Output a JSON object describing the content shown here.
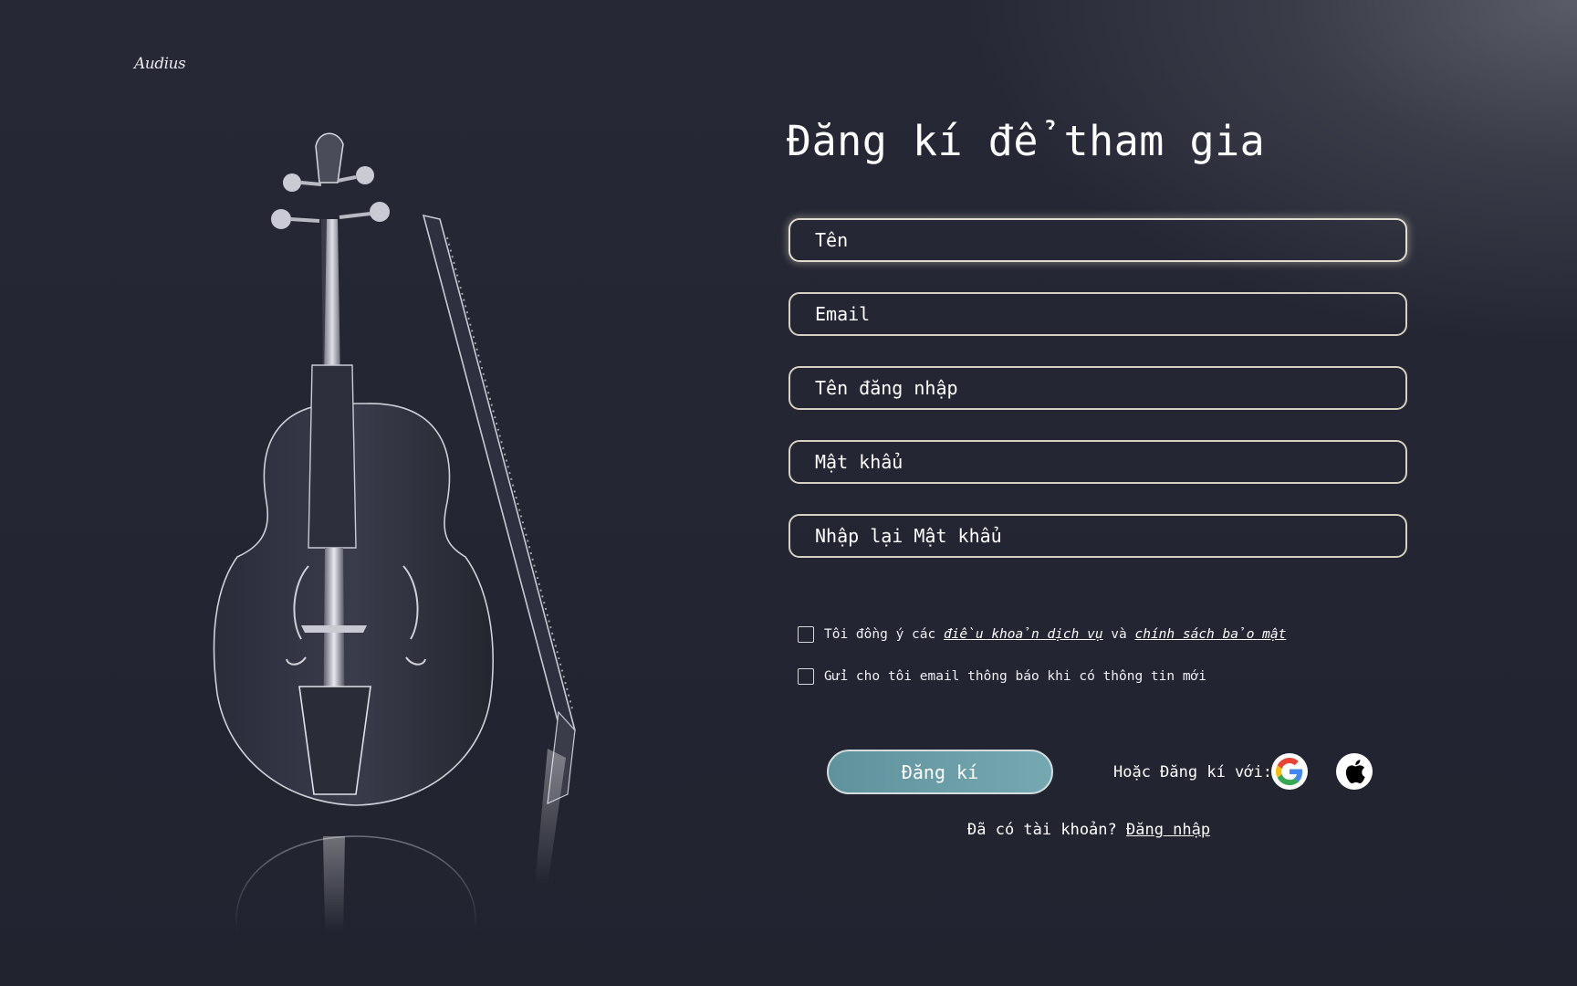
{
  "brand": {
    "logo": "Audius"
  },
  "form": {
    "title": "Đăng kí để tham gia",
    "fields": [
      {
        "placeholder": "Tên"
      },
      {
        "placeholder": "Email"
      },
      {
        "placeholder": "Tên đăng nhập"
      },
      {
        "placeholder": "Mật khẩu"
      },
      {
        "placeholder": "Nhập lại Mật khẩu"
      }
    ],
    "terms": {
      "prefix": "Tôi đồng ý các ",
      "terms_link": "điều khoản dịch vụ",
      "and": " và ",
      "privacy_link": "chính sách bảo mật"
    },
    "newsletter": "Gửi cho tôi email thông báo khi có thông tin mới",
    "submit_label": "Đăng kí",
    "or_signup_with": "Hoặc Đăng kí với:",
    "social": [
      "google-icon",
      "apple-icon"
    ],
    "have_account": "Đã có tài khoản? ",
    "login_link": "Đăng nhập"
  },
  "colors": {
    "button": "#6ba0a9",
    "field_border": "#d5d0c0",
    "background": "#262836"
  }
}
